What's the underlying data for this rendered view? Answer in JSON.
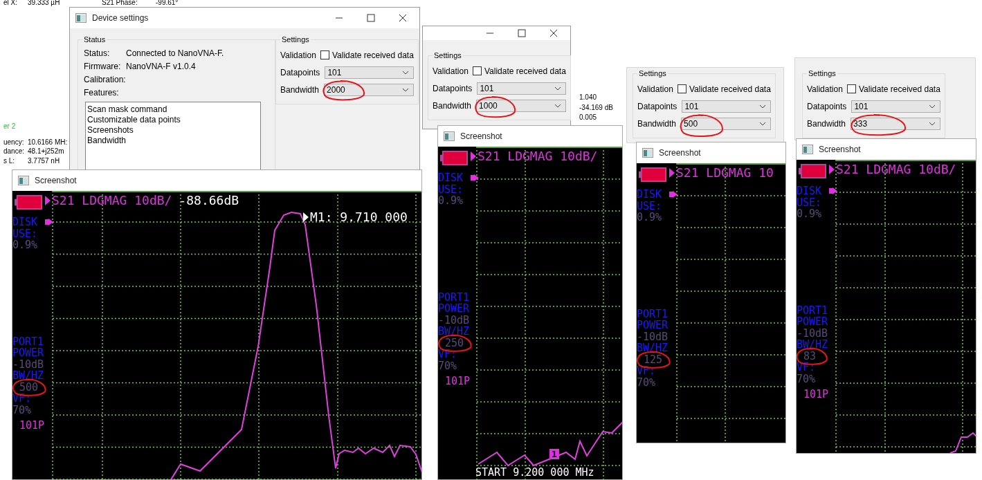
{
  "background_text": [
    "el X:",
    "39.333 µH",
    "S21 Phase:",
    "-99.61°",
    "er 2",
    "uency:",
    "10.6166 MH:",
    "dance:",
    "48.1+j252m",
    "s L:",
    "3.7757 nH",
    "1.040",
    "-34.169 dB",
    "0.005"
  ],
  "device_settings": {
    "title": "Device settings",
    "status": {
      "title": "Status",
      "rows": [
        {
          "label": "Status:",
          "value": "Connected to NanoVNA-F."
        },
        {
          "label": "Firmware:",
          "value": "NanoVNA-F v1.0.4"
        },
        {
          "label": "Calibration:"
        }
      ],
      "features_label": "Features:",
      "features": [
        "Scan mask command",
        "Customizable data points",
        "Screenshots",
        "Bandwidth"
      ]
    }
  },
  "panels": [
    {
      "settings": {
        "title": "Settings",
        "validation_label": "Validation",
        "validate": {
          "label": "Validate received data",
          "checked": false
        },
        "datapoints_label": "Datapoints",
        "datapoints": "101",
        "bandwidth_label": "Bandwidth",
        "bandwidth": "2000",
        "bandwidth_circled": true
      },
      "screenshot": {
        "title": "Screenshot",
        "header": "S21 LDGMAG 10dB/",
        "reading": "-88.66dB",
        "marker": "M1: 9.710 000",
        "top_labels": [
          {
            "text": "DISK",
            "kind": "label"
          },
          {
            "text": "USE:",
            "kind": "label"
          },
          {
            "text": "0.9%",
            "kind": "value"
          }
        ],
        "bottom_labels": [
          {
            "text": "PORT1",
            "kind": "label"
          },
          {
            "text": "POWER",
            "kind": "label"
          },
          {
            "text": "-10dB",
            "kind": "value"
          },
          {
            "text": "BW/HZ",
            "kind": "label"
          },
          {
            "text": "500",
            "kind": "bw"
          },
          {
            "text": "VF:",
            "kind": "label"
          },
          {
            "text": "70%",
            "kind": "value"
          },
          {
            "text": "101P",
            "kind": "points"
          }
        ],
        "bw_circled": true
      }
    },
    {
      "settings": {
        "title": "Settings",
        "validation_label": "Validation",
        "validate": {
          "label": "Validate received data",
          "checked": false
        },
        "datapoints_label": "Datapoints",
        "datapoints": "101",
        "bandwidth_label": "Bandwidth",
        "bandwidth": "1000",
        "bandwidth_circled": true
      },
      "screenshot": {
        "title": "Screenshot",
        "header": "S21 LDGMAG 10dB/",
        "marker_flag": "1",
        "start": "START 9.200 000 MHz",
        "top_labels": [
          {
            "text": "DISK",
            "kind": "label"
          },
          {
            "text": "USE:",
            "kind": "label"
          },
          {
            "text": "0.9%",
            "kind": "value"
          }
        ],
        "bottom_labels": [
          {
            "text": "PORT1",
            "kind": "label"
          },
          {
            "text": "POWER",
            "kind": "label"
          },
          {
            "text": "-10dB",
            "kind": "value"
          },
          {
            "text": "BW/HZ",
            "kind": "label"
          },
          {
            "text": "250",
            "kind": "bw"
          },
          {
            "text": "VF:",
            "kind": "label"
          },
          {
            "text": "70%",
            "kind": "value"
          },
          {
            "text": "101P",
            "kind": "points"
          }
        ],
        "bw_circled": true
      }
    },
    {
      "settings": {
        "title": "Settings",
        "validation_label": "Validation",
        "validate": {
          "label": "Validate received data",
          "checked": false
        },
        "datapoints_label": "Datapoints",
        "datapoints": "101",
        "bandwidth_label": "Bandwidth",
        "bandwidth": "500",
        "bandwidth_circled": true
      },
      "screenshot": {
        "title": "Screenshot",
        "header": "S21 LDGMAG 10",
        "top_labels": [
          {
            "text": "DISK",
            "kind": "label"
          },
          {
            "text": "USE:",
            "kind": "label"
          },
          {
            "text": "0.9%",
            "kind": "value"
          }
        ],
        "bottom_labels": [
          {
            "text": "PORT1",
            "kind": "label"
          },
          {
            "text": "POWER",
            "kind": "label"
          },
          {
            "text": "-10dB",
            "kind": "value"
          },
          {
            "text": "BW/HZ",
            "kind": "label"
          },
          {
            "text": "125",
            "kind": "bw"
          },
          {
            "text": "VF:",
            "kind": "label"
          },
          {
            "text": "70%",
            "kind": "value"
          }
        ],
        "bw_circled": true
      }
    },
    {
      "settings": {
        "title": "Settings",
        "validation_label": "Validation",
        "validate": {
          "label": "Validate received data",
          "checked": false
        },
        "datapoints_label": "Datapoints",
        "datapoints": "101",
        "bandwidth_label": "Bandwidth",
        "bandwidth": "333",
        "bandwidth_circled": true
      },
      "screenshot": {
        "title": "Screenshot",
        "header": "S21 LDGMAG 10dB/",
        "top_labels": [
          {
            "text": "DISK",
            "kind": "label"
          },
          {
            "text": "USE:",
            "kind": "label"
          },
          {
            "text": "0.9%",
            "kind": "value"
          }
        ],
        "bottom_labels": [
          {
            "text": "PORT1",
            "kind": "label"
          },
          {
            "text": "POWER",
            "kind": "label"
          },
          {
            "text": "-10dB",
            "kind": "value"
          },
          {
            "text": "BW/HZ",
            "kind": "label"
          },
          {
            "text": "83",
            "kind": "bw"
          },
          {
            "text": "VF:",
            "kind": "label"
          },
          {
            "text": "70%",
            "kind": "value"
          },
          {
            "text": "101P",
            "kind": "points"
          }
        ],
        "bw_circled": true
      }
    }
  ]
}
